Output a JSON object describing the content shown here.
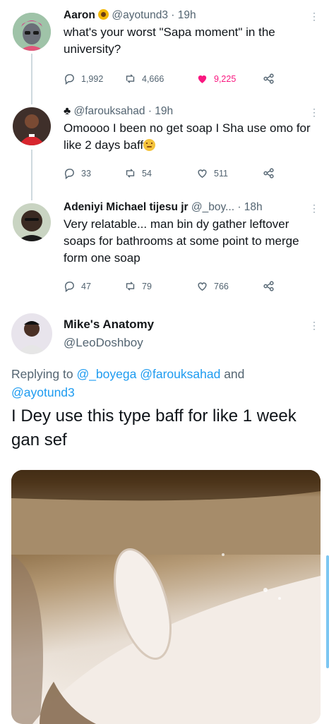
{
  "tweets": [
    {
      "name": "Aaron",
      "handle": "@ayotund3",
      "time": "· 19h",
      "text": "what's your worst \"Sapa moment\" in the university?",
      "replies": "1,992",
      "retweets": "4,666",
      "likes": "9,225"
    },
    {
      "handle": "@farouksahad",
      "time": "· 19h",
      "text": "Omoooo I been no get soap I Sha use omo for like 2 days baff",
      "replies": "33",
      "retweets": "54",
      "likes": "511"
    },
    {
      "name": "Adeniyi Michael tijesu jr",
      "handle": "@_boy...",
      "time": "· 18h",
      "text": "Very relatable... man bin dy gather leftover soaps for bathrooms at some point to merge form one soap",
      "replies": "47",
      "retweets": "79",
      "likes": "766"
    }
  ],
  "main_tweet": {
    "name": "Mike's Anatomy",
    "handle": "@LeoDoshboy",
    "replying_prefix": "Replying to",
    "mention_1": "@_boyega",
    "mention_2": "@farouksahad",
    "and_word": "and",
    "mention_3": "@ayotund3",
    "text": "I Dey use this type baff for like 1 week gan sef"
  },
  "icons": {
    "reply": "reply-icon",
    "retweet": "retweet-icon",
    "like": "heart-icon",
    "share": "share-icon",
    "more": "more-vertical-icon"
  },
  "colors": {
    "like_active": "#f91880",
    "link": "#1d9bf0",
    "muted": "#536471"
  }
}
